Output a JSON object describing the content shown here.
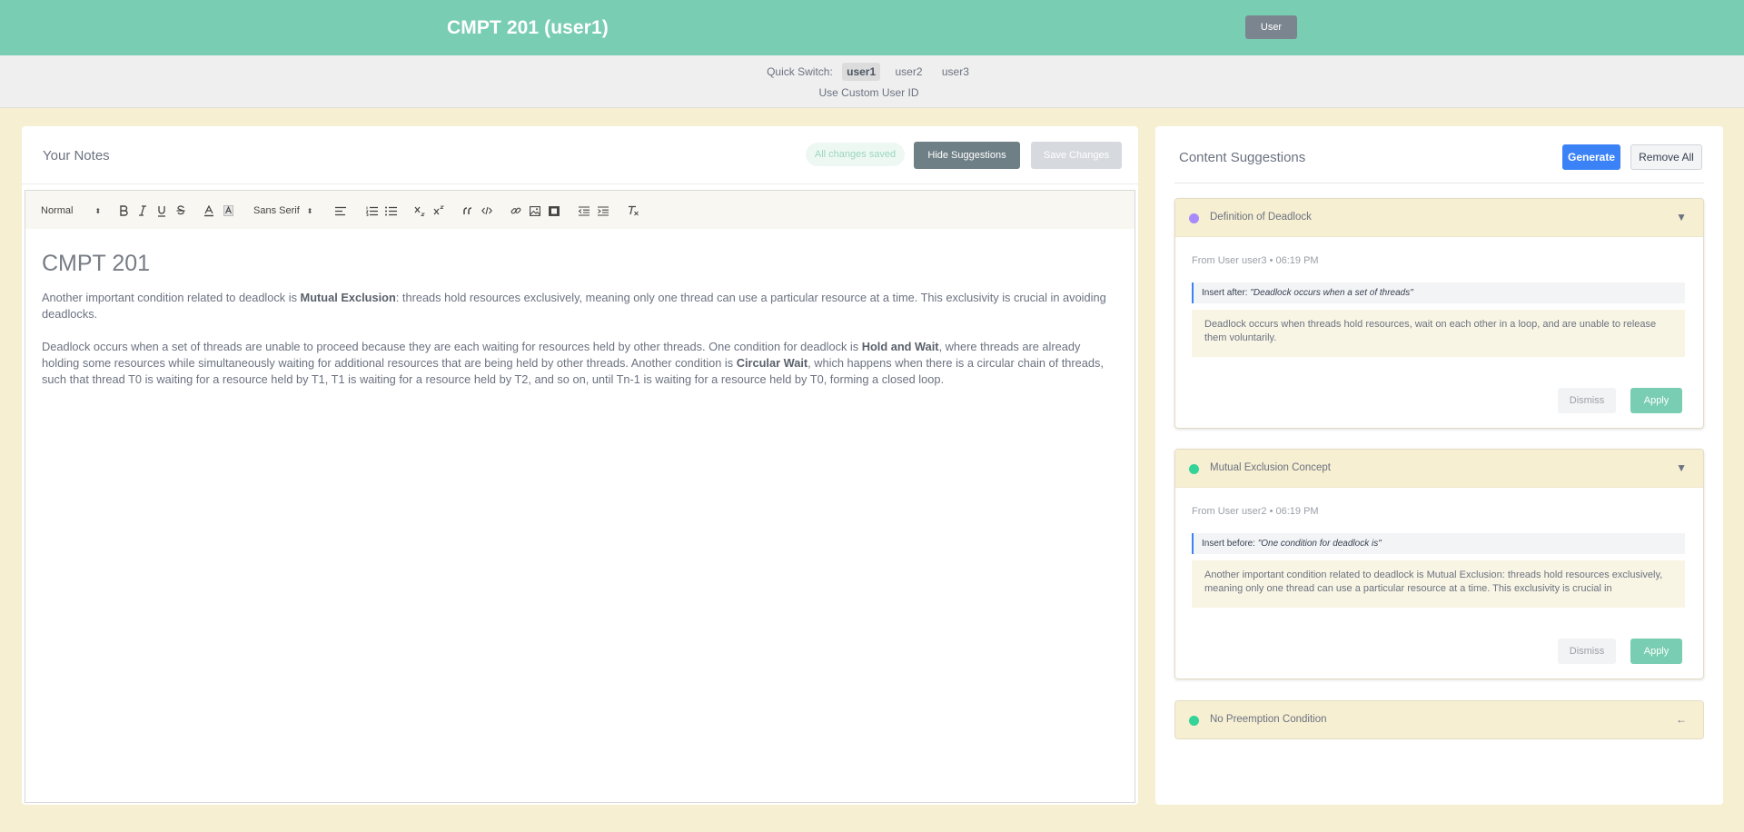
{
  "header": {
    "title": "CMPT 201 (user1)",
    "user_button": "User",
    "bg_color": "#79cdb2"
  },
  "quick_switch": {
    "label": "Quick Switch:",
    "users": [
      "user1",
      "user2",
      "user3"
    ],
    "active_user": "user1",
    "custom_id_link": "Use Custom User ID"
  },
  "notes": {
    "title": "Your Notes",
    "status": "All changes saved",
    "hide_suggestions_label": "Hide Suggestions",
    "save_changes_label": "Save Changes",
    "toolbar": {
      "header_select": "Normal",
      "font_select": "Sans Serif",
      "buttons": [
        "bold",
        "italic",
        "underline",
        "strike",
        "font-color",
        "background-color",
        "align",
        "ordered-list",
        "bullet-list",
        "subscript",
        "superscript",
        "blockquote",
        "code-block",
        "link",
        "image",
        "video",
        "indent-decrease",
        "indent-increase",
        "clear-formatting"
      ]
    },
    "document": {
      "heading": "CMPT 201",
      "p1": {
        "pre": "Another important condition related to deadlock is ",
        "bold": "Mutual Exclusion",
        "post": ": threads hold resources exclusively, meaning only one thread can use a particular resource at a time. This exclusivity is crucial in avoiding deadlocks."
      },
      "p2": {
        "a": "Deadlock occurs when a set of threads are unable to proceed because they are each waiting for resources held by other threads. One condition for deadlock is ",
        "b": "Hold and Wait",
        "c": ", where threads are already holding some resources while simultaneously waiting for additional resources that are being held by other threads. Another condition is ",
        "d": "Circular Wait",
        "e": ", which happens when there is a circular chain of threads, such that thread T0 is waiting for a resource held by T1, T1 is waiting for a resource held by T2, and so on, until Tn-1 is waiting for a resource held by T0, forming a closed loop."
      }
    }
  },
  "suggestions": {
    "title": "Content Suggestions",
    "generate_label": "Generate",
    "remove_all_label": "Remove All",
    "cards": [
      {
        "title": "Definition of Deadlock",
        "dot_color": "#a78bfa",
        "toggle": "▼",
        "meta": "From User user3 • 06:19 PM",
        "insert_label": "Insert after:",
        "insert_anchor": "\"Deadlock occurs when a set of threads\"",
        "content": "Deadlock occurs when threads hold resources, wait on each other in a loop, and are unable to release them voluntarily.",
        "dismiss_label": "Dismiss",
        "apply_label": "Apply"
      },
      {
        "title": "Mutual Exclusion Concept",
        "dot_color": "#34d399",
        "toggle": "▼",
        "meta": "From User user2 • 06:19 PM",
        "insert_label": "Insert before:",
        "insert_anchor": "\"One condition for deadlock is\"",
        "content": "Another important condition related to deadlock is Mutual Exclusion: threads hold resources exclusively, meaning only one thread can use a particular resource at a time. This exclusivity is crucial in",
        "dismiss_label": "Dismiss",
        "apply_label": "Apply"
      },
      {
        "title": "No Preemption Condition",
        "dot_color": "#34d399",
        "toggle": "←"
      }
    ]
  }
}
